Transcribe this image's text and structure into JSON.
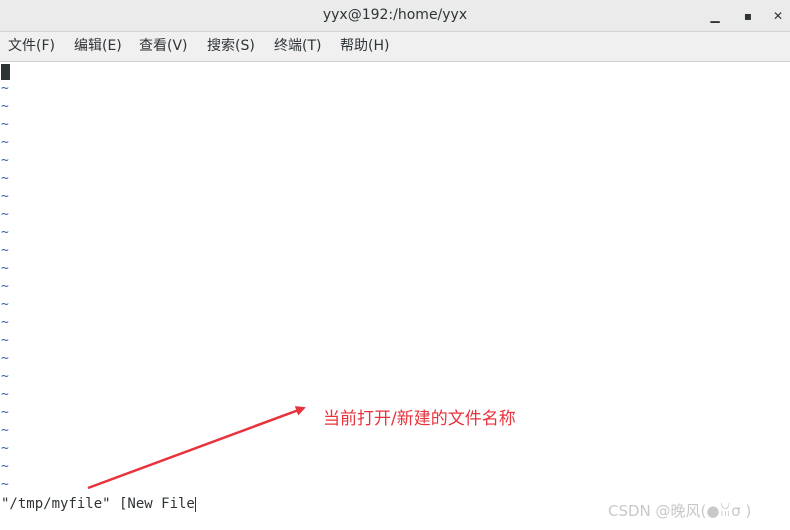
{
  "window": {
    "title": "yyx@192:/home/yyx",
    "minimize_glyph": "▁",
    "maximize_glyph": "▪",
    "close_glyph": "✕",
    "titlebar_color": "#ebebeb",
    "menubar_color": "#f0f0f0"
  },
  "menu": {
    "items": [
      {
        "label": "文件(F)"
      },
      {
        "label": "编辑(E)"
      },
      {
        "label": "查看(V)"
      },
      {
        "label": "搜索(S)"
      },
      {
        "label": "终端(T)"
      },
      {
        "label": "帮助(H)"
      }
    ]
  },
  "terminal": {
    "tilde_char": "~",
    "tilde_color": "#3465a4",
    "tilde_count": 23,
    "status_line": "\"/tmp/myfile\" [New File"
  },
  "annotation": {
    "text": "当前打开/新建的文件名称",
    "color": "#e8323c"
  },
  "watermark": {
    "text": "CSDN @晚风(●ꈍσ )"
  }
}
